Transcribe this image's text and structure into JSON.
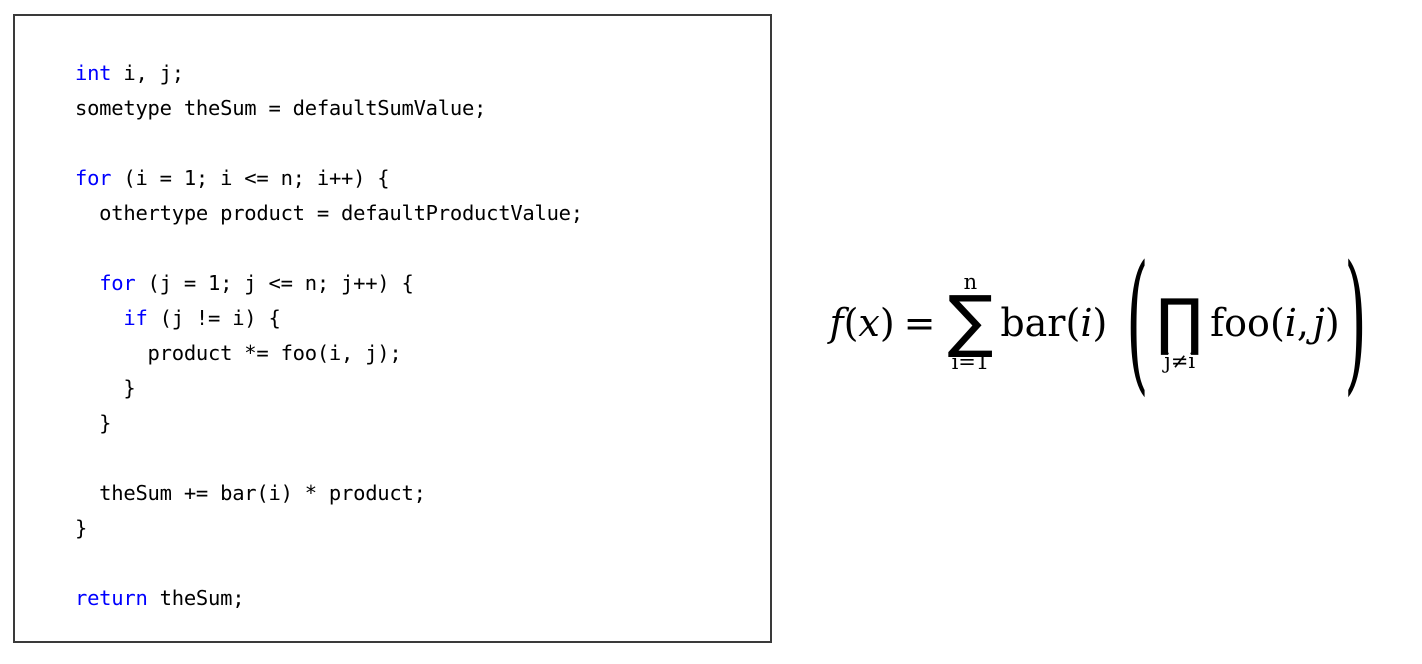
{
  "page": {
    "background_color": "#ffffff",
    "text_color": "#000000"
  },
  "code_panel": {
    "border_color": "#3a3a3a",
    "keyword_color": "#0000ff",
    "language": "C",
    "lines": [
      {
        "id": "line-1",
        "indent": 0,
        "text": "int i, j;",
        "keyword": "int"
      },
      {
        "id": "line-2",
        "indent": 0,
        "text": "sometype theSum = defaultSumValue;",
        "keyword": ""
      },
      {
        "id": "line-3",
        "indent": 0,
        "text": "",
        "keyword": ""
      },
      {
        "id": "line-4",
        "indent": 0,
        "text": "for (i = 1; i <= n; i++) {",
        "keyword": "for"
      },
      {
        "id": "line-5",
        "indent": 2,
        "text": "othertype product = defaultProductValue;",
        "keyword": ""
      },
      {
        "id": "line-6",
        "indent": 0,
        "text": "",
        "keyword": ""
      },
      {
        "id": "line-7",
        "indent": 2,
        "text": "for (j = 1; j <= n; j++) {",
        "keyword": "for"
      },
      {
        "id": "line-8",
        "indent": 4,
        "text": "if (j != i) {",
        "keyword": "if"
      },
      {
        "id": "line-9",
        "indent": 6,
        "text": "product *= foo(i, j);",
        "keyword": ""
      },
      {
        "id": "line-10",
        "indent": 4,
        "text": "}",
        "keyword": ""
      },
      {
        "id": "line-11",
        "indent": 2,
        "text": "}",
        "keyword": ""
      },
      {
        "id": "line-12",
        "indent": 0,
        "text": "",
        "keyword": ""
      },
      {
        "id": "line-13",
        "indent": 2,
        "text": "theSum += bar(i) * product;",
        "keyword": ""
      },
      {
        "id": "line-14",
        "indent": 0,
        "text": "}",
        "keyword": ""
      },
      {
        "id": "line-15",
        "indent": 0,
        "text": "",
        "keyword": ""
      },
      {
        "id": "line-16",
        "indent": 0,
        "text": "return theSum;",
        "keyword": "return"
      }
    ]
  },
  "formula": {
    "latex": "f(x) = \\sum_{i=1}^{n} \\mathrm{bar}(i) \\left( \\prod_{j \\neq i} \\mathrm{foo}(i,j) \\right)",
    "plain": "f(x) = sum from i=1 to n of bar(i) ( product over j != i of foo(i,j) )",
    "lhs_f": "f",
    "lhs_open": "(",
    "lhs_var": "x",
    "lhs_close": ")",
    "equals": "=",
    "sum_glyph": "∑",
    "sum_upper": "n",
    "sum_lower": "i=1",
    "bar_name": "bar",
    "bar_open": "(",
    "bar_arg": "i",
    "bar_close": ")",
    "paren_open": "(",
    "prod_glyph": "∏",
    "prod_lower": "j≠i",
    "foo_name": "foo",
    "foo_open": "(",
    "foo_arg1": "i",
    "foo_comma": ",",
    "foo_arg2": "j",
    "foo_close": ")",
    "paren_close": ")"
  }
}
